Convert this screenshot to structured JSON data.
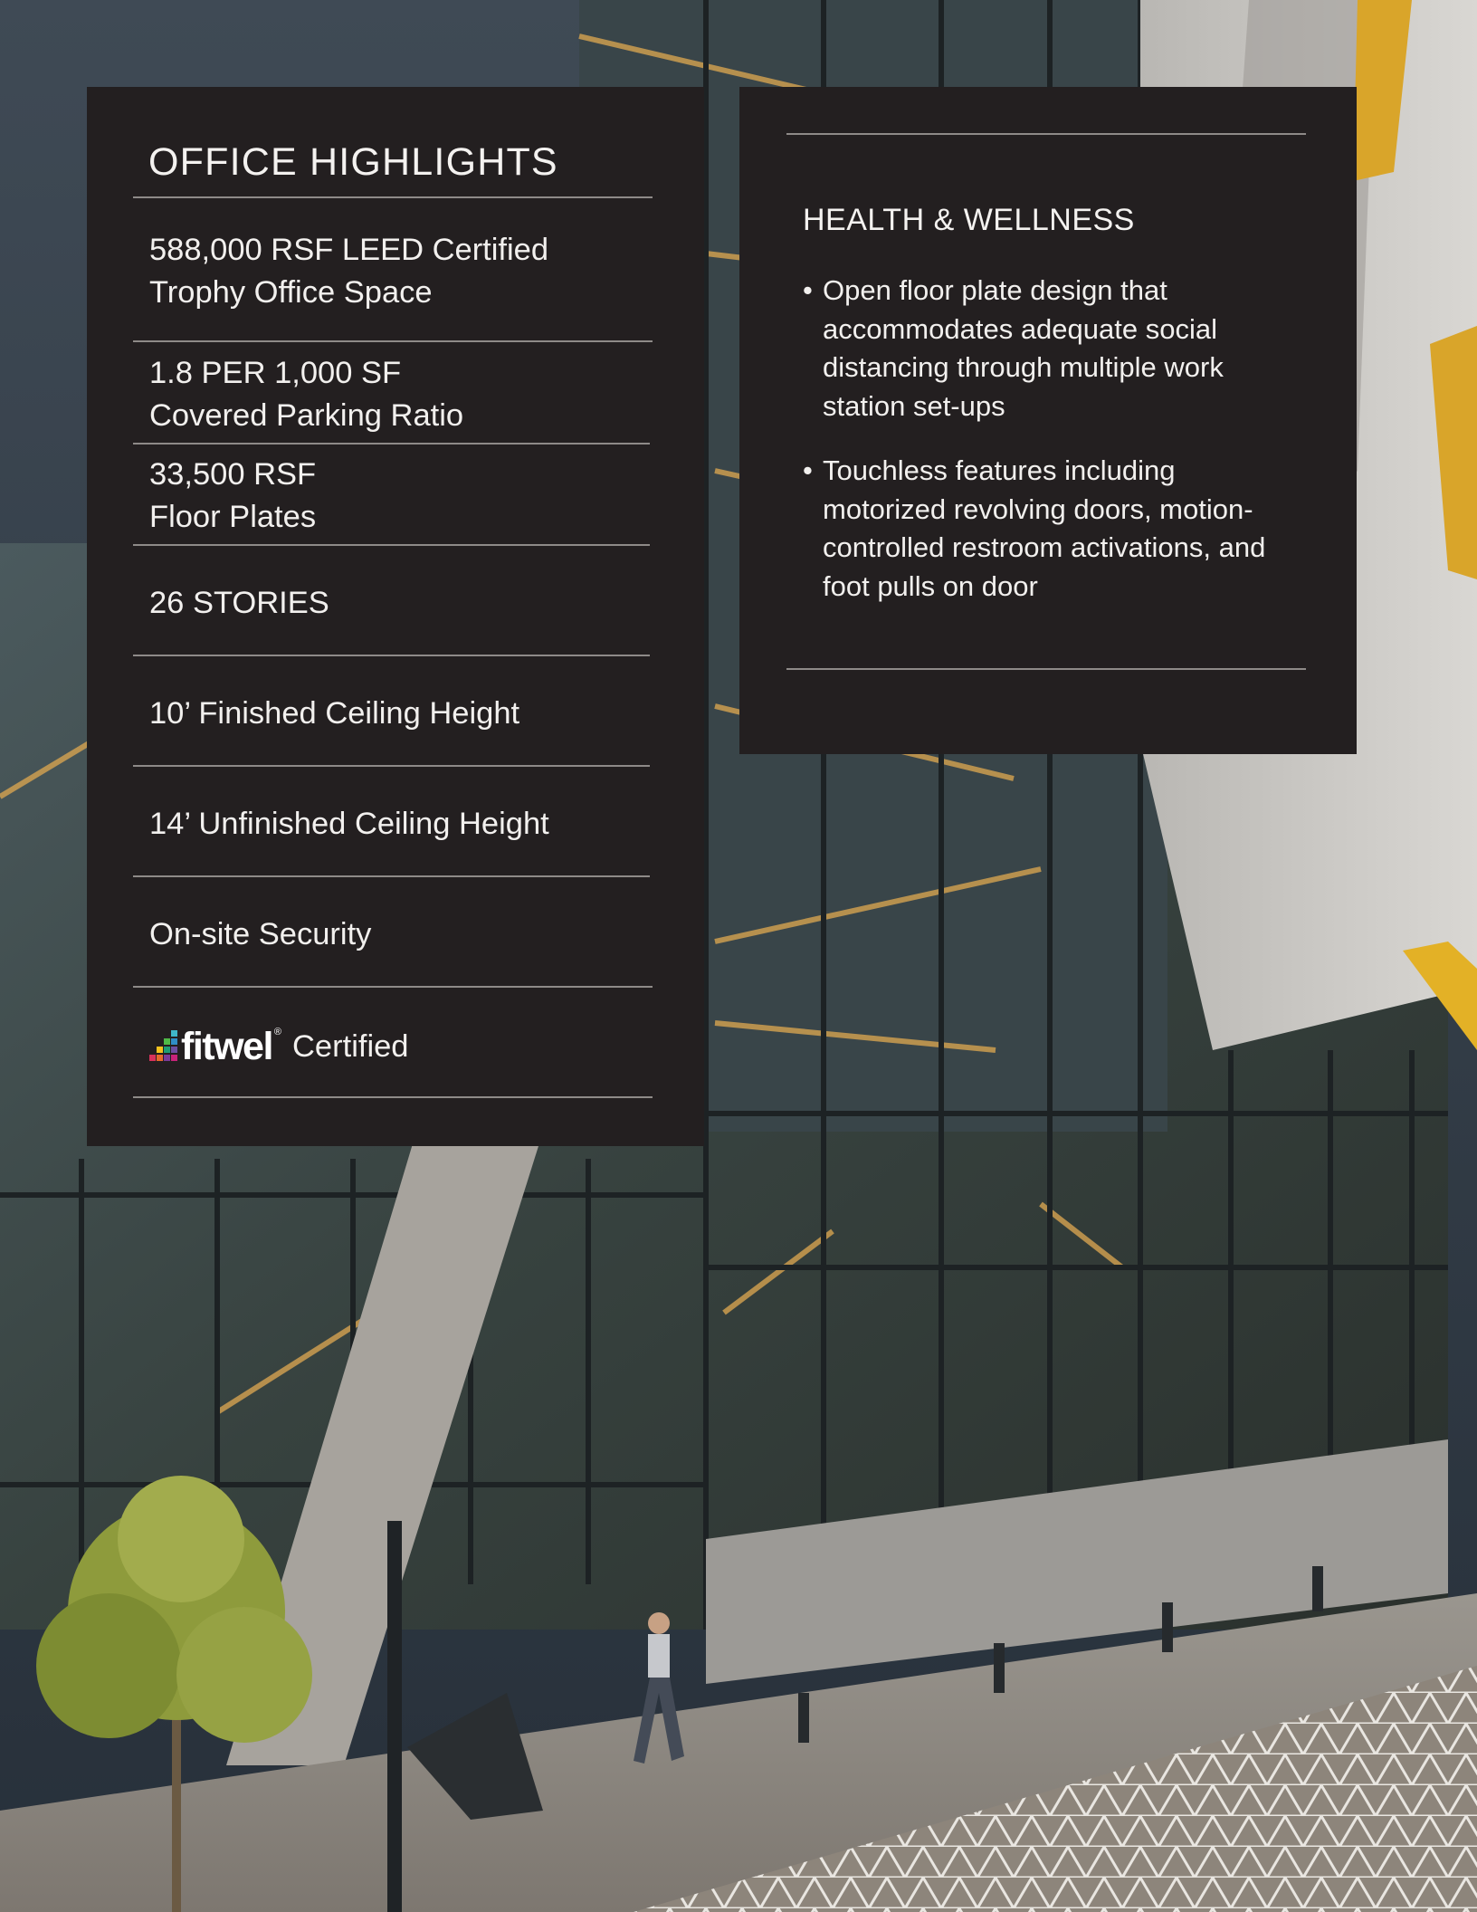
{
  "colors": {
    "card_background": "#231f20",
    "text": "#f2f0ee",
    "divider": "#8e8a88",
    "accent_gold": "#e8b43c"
  },
  "background_photo": {
    "icons": [
      "building-facade-photo",
      "pedestrian-figure",
      "street-lamp",
      "tree"
    ]
  },
  "office_highlights": {
    "title": "OFFICE HIGHLIGHTS",
    "items": [
      {
        "lines": [
          "588,000 RSF LEED Certified",
          "Trophy Office Space"
        ]
      },
      {
        "lines": [
          "1.8 PER 1,000 SF",
          "Covered Parking Ratio"
        ]
      },
      {
        "lines": [
          "33,500 RSF",
          "Floor Plates"
        ]
      },
      {
        "lines": [
          "26 STORIES"
        ]
      },
      {
        "lines": [
          "10’ Finished Ceiling Height"
        ]
      },
      {
        "lines": [
          "14’ Unfinished Ceiling Height"
        ]
      },
      {
        "lines": [
          "On-site Security"
        ]
      }
    ],
    "fitwel": {
      "logo_text": "fitwel",
      "registered": "®",
      "label": "Certified",
      "logo_icon": "fitwel-logo-icon"
    }
  },
  "health_wellness": {
    "title": "HEALTH & WELLNESS",
    "bullets": [
      "Open floor plate design that accommodates adequate social distancing through multiple work station set-ups",
      "Touchless features including motorized revolving doors, motion-controlled restroom activations, and foot pulls on door"
    ],
    "bullet_glyph": "•"
  }
}
